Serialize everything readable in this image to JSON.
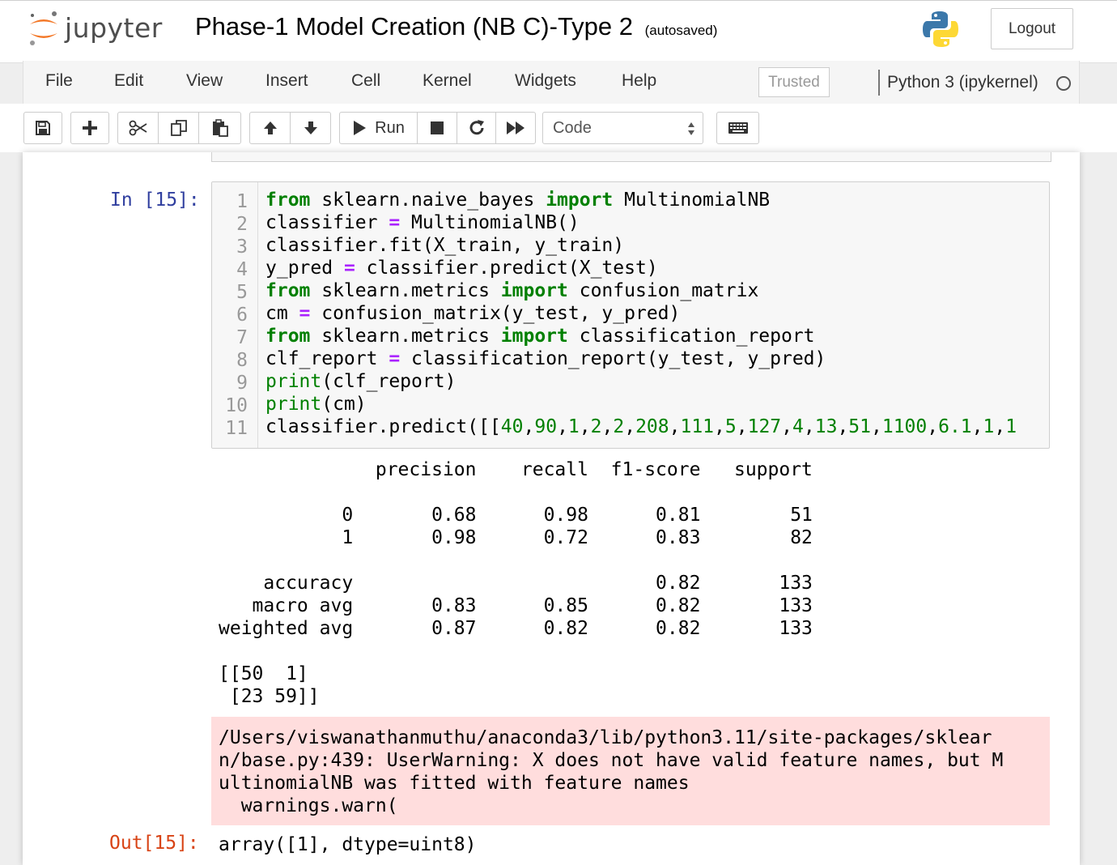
{
  "header": {
    "logo_text": "jupyter",
    "notebook_title": "Phase-1 Model Creation (NB C)-Type 2",
    "autosave": "(autosaved)",
    "logout_label": "Logout"
  },
  "menu": {
    "items": [
      "File",
      "Edit",
      "View",
      "Insert",
      "Cell",
      "Kernel",
      "Widgets",
      "Help"
    ],
    "trusted": "Trusted",
    "kernel": "Python 3 (ipykernel)"
  },
  "toolbar": {
    "run_label": "Run",
    "cell_type": "Code",
    "buttons": [
      "save",
      "insert-cell-below",
      "cut",
      "copy",
      "paste",
      "move-up",
      "move-down",
      "run",
      "interrupt",
      "restart",
      "restart-run-all",
      "command-palette"
    ]
  },
  "cell": {
    "in_prompt": "In [15]:",
    "line_numbers": [
      "1",
      "2",
      "3",
      "4",
      "5",
      "6",
      "7",
      "8",
      "9",
      "10",
      "11"
    ],
    "code": {
      "l1": [
        "from",
        " sklearn.naive_bayes ",
        "import",
        " MultinomialNB"
      ],
      "l2": [
        "classifier ",
        "=",
        " MultinomialNB()"
      ],
      "l3": [
        "classifier.fit(X_train, y_train)"
      ],
      "l4": [
        "y_pred ",
        "=",
        " classifier.predict(X_test)"
      ],
      "l5": [
        "from",
        " sklearn.metrics ",
        "import",
        " confusion_matrix"
      ],
      "l6": [
        "cm ",
        "=",
        " confusion_matrix(y_test, y_pred)"
      ],
      "l7": [
        "from",
        " sklearn.metrics ",
        "import",
        " classification_report"
      ],
      "l8": [
        "clf_report ",
        "=",
        " classification_report(y_test, y_pred)"
      ],
      "l9": [
        "print",
        "(clf_report)"
      ],
      "l10": [
        "print",
        "(cm)"
      ],
      "l11": [
        "classifier.predict([[",
        "40",
        ",",
        "90",
        ",",
        "1",
        ",",
        "2",
        ",",
        "2",
        ",",
        "208",
        ",",
        "111",
        ",",
        "5",
        ",",
        "127",
        ",",
        "4",
        ",",
        "13",
        ",",
        "51",
        ",",
        "1100",
        ",",
        "6.1",
        ",",
        "1",
        ",",
        "1"
      ]
    },
    "report": {
      "header": "              precision    recall  f1-score   support",
      "row0": "           0       0.68      0.98      0.81        51",
      "row1": "           1       0.98      0.72      0.83        82",
      "accuracy": "    accuracy                           0.82       133",
      "macro": "   macro avg       0.83      0.85      0.82       133",
      "weighted": "weighted avg       0.87      0.82      0.82       133"
    },
    "matrix": {
      "line1": "[[50  1]",
      "line2": " [23 59]]"
    },
    "stderr": {
      "line1": "/Users/viswanathanmuthu/anaconda3/lib/python3.11/site-packages/sklear",
      "line2": "n/base.py:439: UserWarning: X does not have valid feature names, but M",
      "line3": "ultinomialNB was fitted with feature names",
      "line4": "  warnings.warn("
    },
    "out_prompt": "Out[15]:",
    "out_value": "array([1], dtype=uint8)"
  },
  "colors": {
    "keyword": "#008000",
    "operator": "#aa22ff",
    "in_prompt": "#303f9f",
    "out_prompt": "#d84315",
    "stderr_bg": "#ffdddd"
  }
}
